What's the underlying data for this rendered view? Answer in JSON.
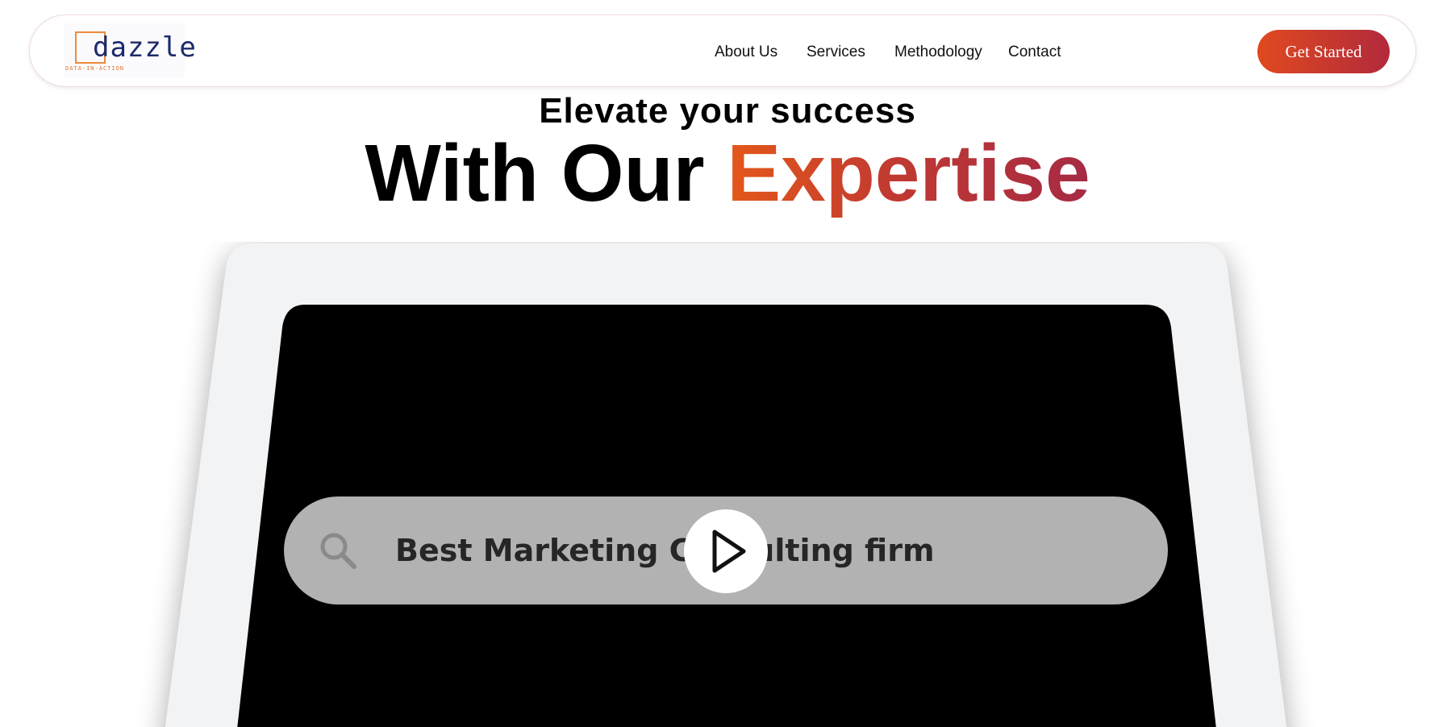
{
  "header": {
    "logo": {
      "wordmark": "dazzle",
      "tagline": "DATA-IN-ACTION"
    },
    "nav": [
      {
        "label": "About Us"
      },
      {
        "label": "Services"
      },
      {
        "label": "Methodology"
      },
      {
        "label": "Contact"
      }
    ],
    "cta_label": "Get Started"
  },
  "hero": {
    "subtitle": "Elevate your success",
    "title_lead": "With Our",
    "title_accent": "Expertise"
  },
  "video": {
    "search_text": "Best Marketing Consulting firm",
    "play_icon": "play-icon",
    "search_icon": "search-icon"
  },
  "colors": {
    "accent_start": "#e0491f",
    "accent_end": "#b12a3c",
    "logo_blue": "#1c2a6b",
    "logo_orange": "#ef8a3b"
  }
}
